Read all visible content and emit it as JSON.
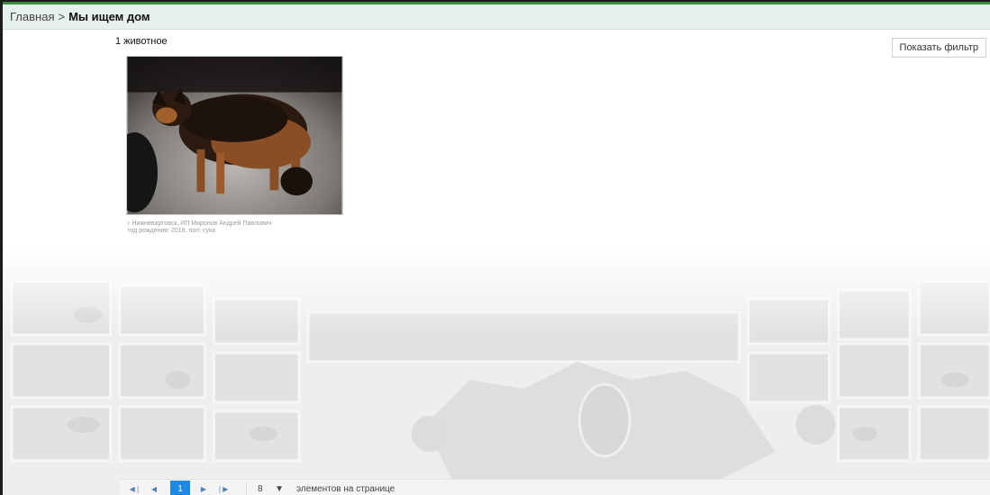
{
  "breadcrumb": {
    "home": "Главная",
    "separator": ">",
    "current": "Мы ищем дом"
  },
  "results": {
    "count_label": "1 животное"
  },
  "filter_button": {
    "label": "Показать фильтр"
  },
  "animals": [
    {
      "caption_line1": "г Нижневартовск, ИП Миронов Андрей Павлович",
      "caption_line2": "год рождения: 2019, пол: сука"
    }
  ],
  "pager": {
    "first_icon": "first-page-icon",
    "prev_icon": "prev-page-icon",
    "next_icon": "next-page-icon",
    "last_icon": "last-page-icon",
    "current_page": "1",
    "page_size": "8",
    "per_page_label": "элементов на странице"
  },
  "colors": {
    "accent": "#1e88e5",
    "breadcrumb_bg": "#e6f0ee",
    "top_strip": "#3b8c3b"
  }
}
